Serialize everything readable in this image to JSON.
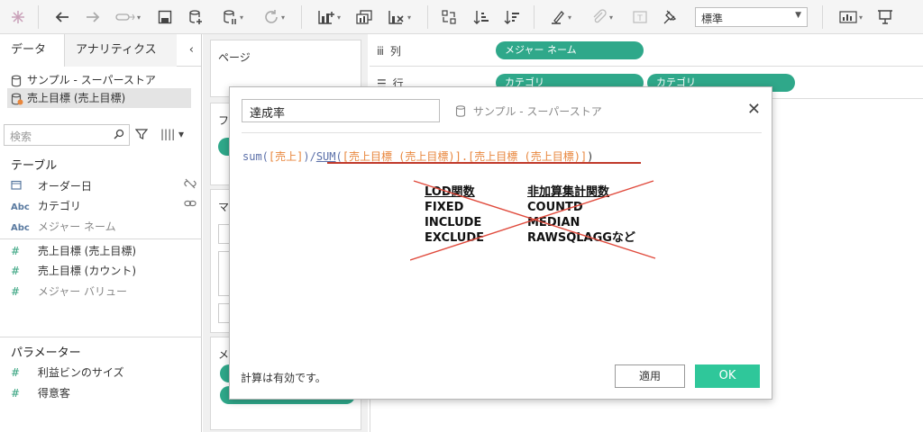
{
  "toolbar": {
    "font_select": "標準"
  },
  "left_panel": {
    "tabs": [
      "データ",
      "アナリティクス"
    ],
    "collapse": "‹",
    "datasources": [
      {
        "label": "サンプル - スーパーストア"
      },
      {
        "label": "売上目標 (売上目標)"
      }
    ],
    "search_placeholder": "検索",
    "tables_title": "テーブル",
    "fields": [
      {
        "type": "date",
        "icon": "date-icon",
        "label": "オーダー日",
        "link": "link-broken-icon"
      },
      {
        "type": "Abc",
        "label": "カテゴリ",
        "link": "link-icon"
      },
      {
        "type": "Abc",
        "label": "メジャー ネーム",
        "gray": true
      },
      {
        "type": "#",
        "label": "売上目標 (売上目標)"
      },
      {
        "type": "#",
        "label": "売上目標 (カウント)"
      },
      {
        "type": "#",
        "label": "メジャー バリュー",
        "gray": true
      }
    ],
    "parameters_title": "パラメーター",
    "parameters": [
      {
        "type": "#",
        "label": "利益ビンのサイズ"
      },
      {
        "type": "#",
        "label": "得意客"
      }
    ]
  },
  "cards": {
    "pages_title": "ページ",
    "filters_title": "フ",
    "marks_title": "マ",
    "measures_title": "メ"
  },
  "shelves": {
    "columns_label": "列",
    "rows_label": "行",
    "columns_pills": [
      "メジャー ネーム"
    ],
    "rows_pills": [
      "カテゴリ",
      "カテゴリ"
    ]
  },
  "dialog": {
    "calc_name": "達成率",
    "datasource": "サンプル - スーパーストア",
    "formula": {
      "p1": "sum(",
      "p2": "[売上]",
      "p3": ")/",
      "p4": "SUM",
      "p5": "(",
      "p6": "[売上目標 (売上目標)].[売上目標 (売上目標)]",
      "p7": ")"
    },
    "note_left": [
      "LOD関数",
      "FIXED",
      "INCLUDE",
      "EXCLUDE"
    ],
    "note_right": [
      "非加算集計関数",
      "COUNTD",
      "MEDIAN",
      "RAWSQLAGGなど"
    ],
    "status": "計算は有効です。",
    "apply_label": "適用",
    "ok_label": "OK"
  },
  "colors": {
    "accent_green": "#2fa88a",
    "ok_green": "#2fc79a",
    "field_orange": "#e8863c",
    "func_blue": "#5a6fa8",
    "strike_red": "#e04a3c"
  }
}
